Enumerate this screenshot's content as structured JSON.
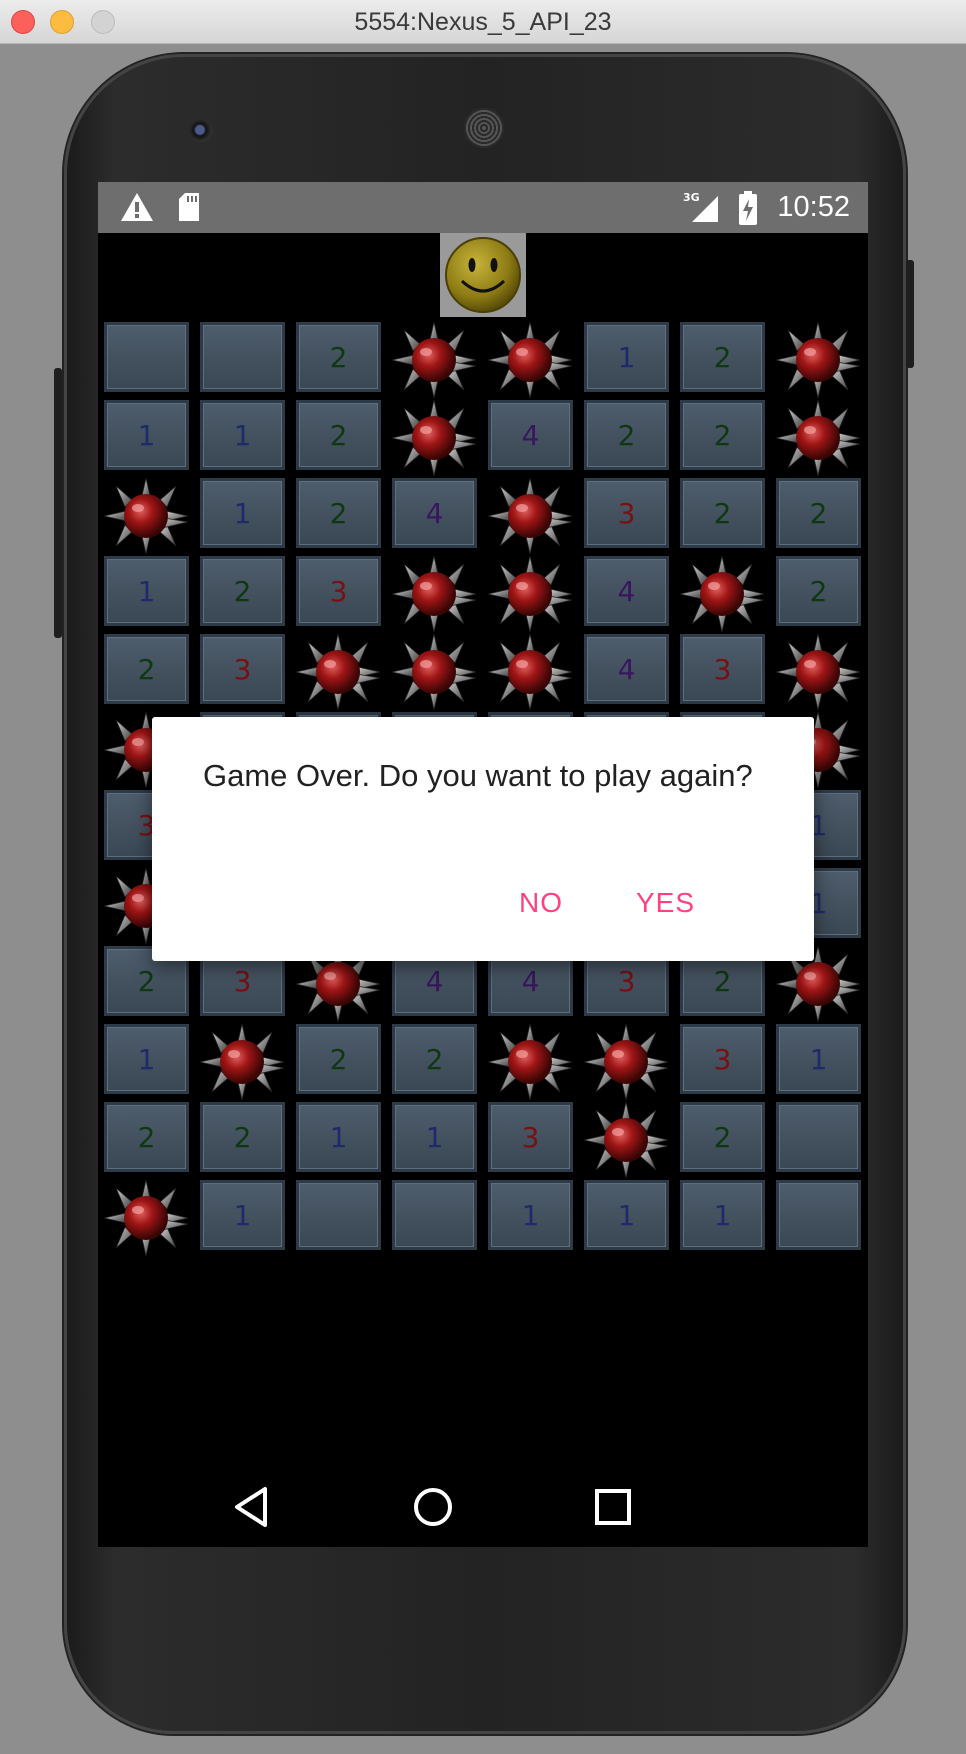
{
  "window": {
    "title": "5554:Nexus_5_API_23"
  },
  "status_bar": {
    "time": "10:52",
    "network_label": "3G",
    "icons": [
      "warning-icon",
      "sd-card-icon",
      "signal-icon",
      "battery-charging-icon"
    ]
  },
  "game": {
    "face_icon": "smiley-face-icon",
    "board": [
      [
        "",
        "",
        "2",
        "M",
        "M",
        "1",
        "2",
        "M"
      ],
      [
        "1",
        "1",
        "2",
        "M",
        "4",
        "2",
        "2",
        "M"
      ],
      [
        "M",
        "1",
        "2",
        "4",
        "M",
        "3",
        "2",
        "2"
      ],
      [
        "1",
        "2",
        "3",
        "M",
        "M",
        "4",
        "M",
        "2"
      ],
      [
        "2",
        "3",
        "M",
        "M",
        "M",
        "4",
        "3",
        "M"
      ],
      [
        "M",
        "",
        "",
        "",
        "",
        "",
        "",
        "M"
      ],
      [
        "3",
        "",
        "",
        "",
        "",
        "",
        "",
        "1"
      ],
      [
        "M",
        "",
        "",
        "",
        "",
        "",
        "",
        "1"
      ],
      [
        "2",
        "3",
        "M",
        "4",
        "4",
        "3",
        "2",
        "M"
      ],
      [
        "1",
        "M",
        "2",
        "2",
        "M",
        "M",
        "3",
        "1"
      ],
      [
        "2",
        "2",
        "1",
        "1",
        "3",
        "M",
        "2",
        ""
      ],
      [
        "M",
        "1",
        "",
        "",
        "1",
        "1",
        "1",
        ""
      ]
    ],
    "number_colors": {
      "1": "#1f2a6a",
      "2": "#103810",
      "3": "#7a1010",
      "4": "#3a1560"
    }
  },
  "dialog": {
    "message": "Game Over. Do you want to play again?",
    "no_label": "NO",
    "yes_label": "YES",
    "accent_color": "#ff4081"
  },
  "nav_bar": {
    "icons": [
      "back-icon",
      "home-icon",
      "recents-icon"
    ]
  }
}
